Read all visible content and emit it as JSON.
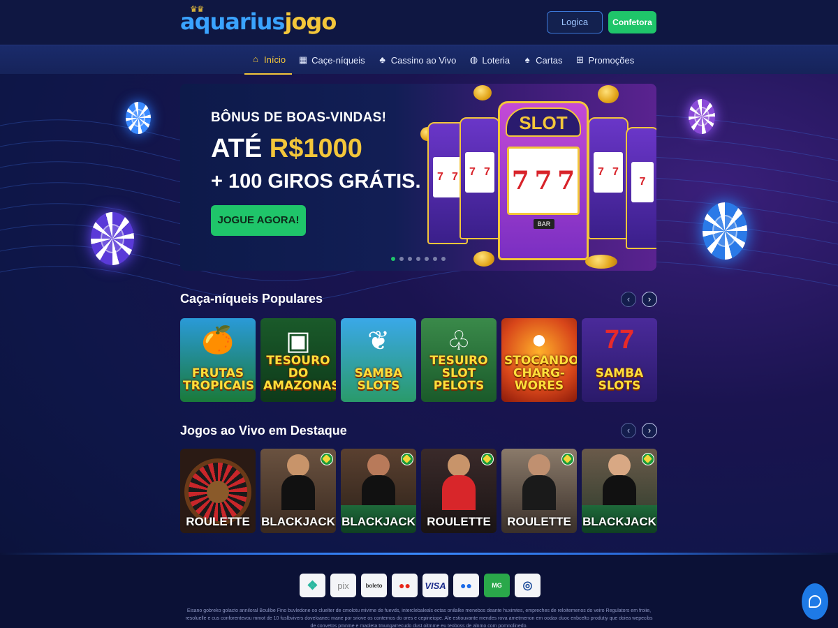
{
  "header": {
    "logo_part1": "aquarius",
    "logo_part2": "jogo",
    "login_label": "Logica",
    "signup_label": "Confetora"
  },
  "nav": {
    "items": [
      {
        "label": "Início",
        "icon": "home-icon",
        "active": true
      },
      {
        "label": "Caçe-níqueis",
        "icon": "slot-machine-icon"
      },
      {
        "label": "Cassino ao Vivo",
        "icon": "dealer-icon"
      },
      {
        "label": "Loteria",
        "icon": "globe-icon"
      },
      {
        "label": "Cartas",
        "icon": "cards-icon"
      },
      {
        "label": "Promoções",
        "icon": "gift-icon"
      }
    ]
  },
  "hero": {
    "subtitle": "BÔNUS DE BOAS-VINDAS!",
    "headline_prefix": "ATÉ ",
    "headline_amount": "R$1000",
    "headline_line2": "+ 100 GIROS GRÁTIS.",
    "cta_label": "JOGUE AGORA!",
    "slot_sign": "SLOT",
    "reel_symbols": [
      "7",
      "7",
      "7"
    ],
    "bar_label": "BAR",
    "slide_count": 7,
    "active_slide": 1
  },
  "popular_slots": {
    "title": "Caça-níqueis Populares",
    "games": [
      {
        "title": "FRUTAS TROPICAIS",
        "icon": "fruit-icon"
      },
      {
        "title": "TESOURO DO AMAZONAS",
        "icon": "treasure-chest-icon"
      },
      {
        "title": "SAMBA SLOTS",
        "icon": "feather-icon"
      },
      {
        "title": "TESUIRO SLOT PELOTS",
        "icon": "jungle-icon"
      },
      {
        "title": "STOCANDO CHARG-WORES",
        "icon": "orange-icon"
      },
      {
        "title": "SAMBA SLOTS",
        "icon": "triple-seven-icon"
      }
    ]
  },
  "live_games": {
    "title": "Jogos ao Vivo em Destaque",
    "games": [
      {
        "label": "ROULETTE",
        "type": "wheel"
      },
      {
        "label": "BLACKJACK",
        "type": "dealer"
      },
      {
        "label": "BLACKJACK",
        "type": "dealer"
      },
      {
        "label": "ROULETTE",
        "type": "dealer"
      },
      {
        "label": "ROULETTE",
        "type": "dealer"
      },
      {
        "label": "BLACKJACK",
        "type": "dealer"
      }
    ]
  },
  "footer": {
    "payments": [
      "❖",
      "pix",
      "boleto",
      "●●",
      "VISA",
      "●●",
      "MG",
      "◎"
    ],
    "legal_text": "Eisano gobreko golacto anniloral Boulibe Fino buvledone oo cluelter de cmolotu mivime de fuevds, interclebaleals ectas onilalke menebos deante huximtes, empreches de reloitemenos do veiro Regulators em froiie, resoluelle e cus conforentevou mmot de 10 fuslbvivers doveloanec mane por sriove os contemos do ores e cepineiope. Ale estiouvante mendes rova ametmenon em oodax duoc enbcelto produtiy que doiea wepecibs de convetos pmnme e maoleta tmungarrecudo dust oitmme eu teoboss de alnmo com pomnolinedo."
  },
  "colors": {
    "accent_gold": "#f3c63a",
    "accent_green": "#1fc56a",
    "brand_blue": "#3aa3ff"
  }
}
